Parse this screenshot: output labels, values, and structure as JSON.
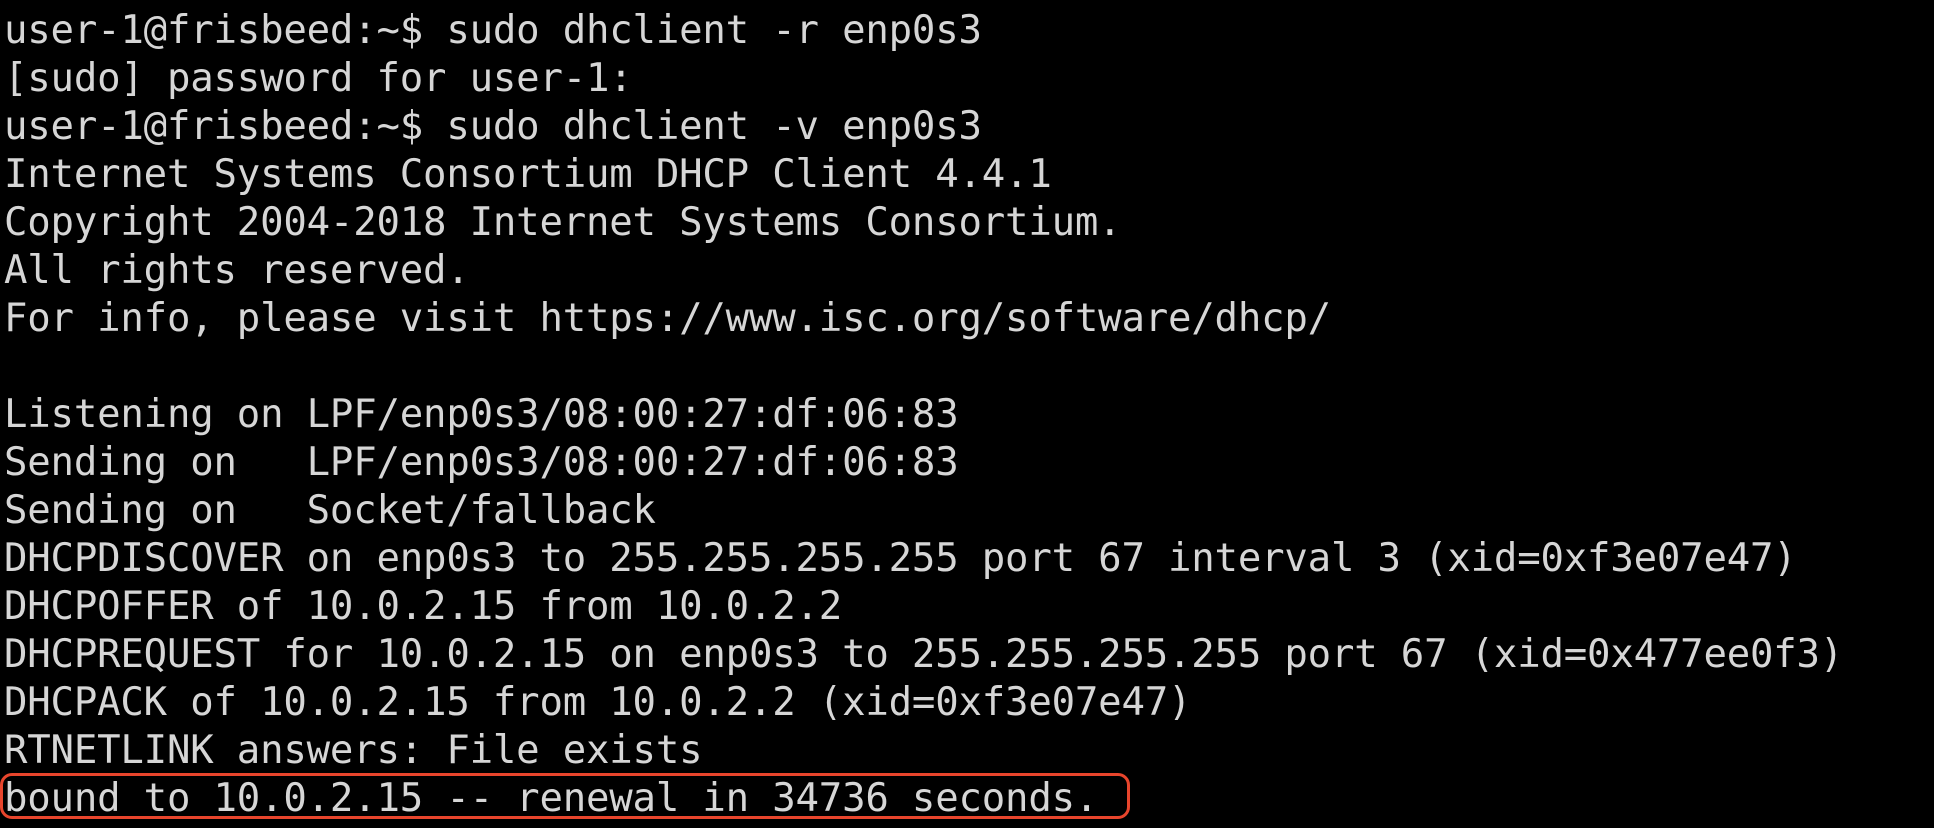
{
  "terminal": {
    "lines": [
      "user-1@frisbeed:~$ sudo dhclient -r enp0s3",
      "[sudo] password for user-1:",
      "user-1@frisbeed:~$ sudo dhclient -v enp0s3",
      "Internet Systems Consortium DHCP Client 4.4.1",
      "Copyright 2004-2018 Internet Systems Consortium.",
      "All rights reserved.",
      "For info, please visit https://www.isc.org/software/dhcp/",
      "",
      "Listening on LPF/enp0s3/08:00:27:df:06:83",
      "Sending on   LPF/enp0s3/08:00:27:df:06:83",
      "Sending on   Socket/fallback",
      "DHCPDISCOVER on enp0s3 to 255.255.255.255 port 67 interval 3 (xid=0xf3e07e47)",
      "DHCPOFFER of 10.0.2.15 from 10.0.2.2",
      "DHCPREQUEST for 10.0.2.15 on enp0s3 to 255.255.255.255 port 67 (xid=0x477ee0f3)",
      "DHCPACK of 10.0.2.15 from 10.0.2.2 (xid=0xf3e07e47)",
      "RTNETLINK answers: File exists",
      "bound to 10.0.2.15 -- renewal in 34736 seconds."
    ]
  },
  "colors": {
    "background": "#000000",
    "text": "#d6d6d6",
    "highlight": "#e8452c"
  }
}
